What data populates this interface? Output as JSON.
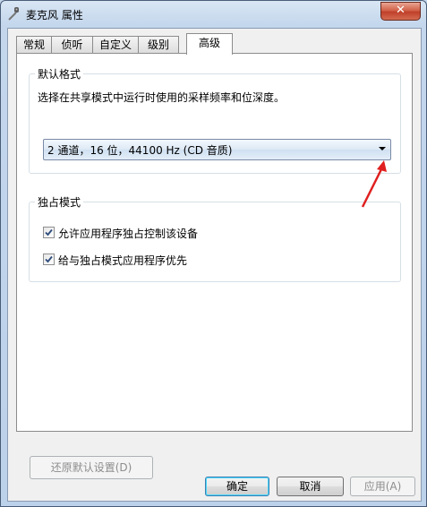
{
  "window": {
    "title": "麦克风 属性",
    "close_label": "✕"
  },
  "tabs": [
    {
      "label": "常规",
      "active": false
    },
    {
      "label": "侦听",
      "active": false
    },
    {
      "label": "自定义",
      "active": false
    },
    {
      "label": "级别",
      "active": false
    },
    {
      "label": "高级",
      "active": true
    }
  ],
  "default_format": {
    "group_label": "默认格式",
    "description": "选择在共享模式中运行时使用的采样频率和位深度。",
    "selected_value": "2 通道，16 位，44100 Hz (CD 音质)"
  },
  "exclusive_mode": {
    "group_label": "独占模式",
    "options": [
      {
        "label": "允许应用程序独占控制该设备",
        "checked": true
      },
      {
        "label": "给与独占模式应用程序优先",
        "checked": true
      }
    ]
  },
  "restore_defaults_label": "还原默认设置(D)",
  "buttons": {
    "ok": "确定",
    "cancel": "取消",
    "apply": "应用(A)"
  },
  "annotation_arrow_color": "#e02020"
}
